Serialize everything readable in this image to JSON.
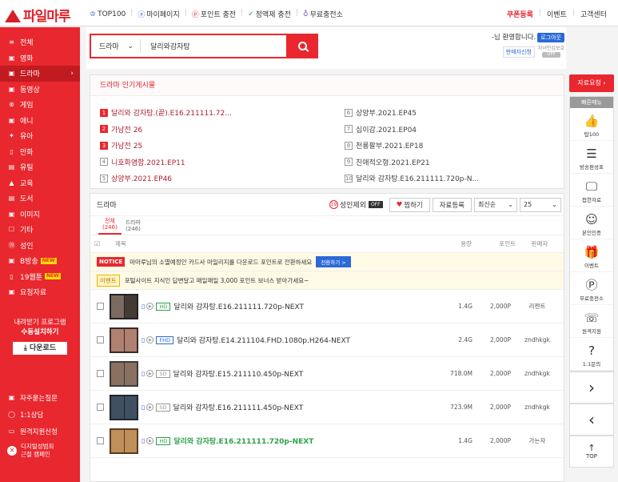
{
  "brand": {
    "name": "파일마루"
  },
  "topnav": [
    {
      "label": "TOP100",
      "icon": "crown-icon",
      "glyph": "♔"
    },
    {
      "label": "마이페이지",
      "icon": "user-icon",
      "glyph": "ⓐ"
    },
    {
      "label": "포인트 충전",
      "icon": "point-icon",
      "glyph": "ⓟ"
    },
    {
      "label": "정액제 충전",
      "icon": "check-circle-icon",
      "glyph": "✓"
    },
    {
      "label": "무료충전소",
      "icon": "gift-icon",
      "glyph": "♁"
    }
  ],
  "toplinks": {
    "coupon": "쿠폰등록",
    "event": "이벤트",
    "support": "고객센터"
  },
  "sidebar": {
    "items": [
      {
        "label": "전체",
        "icon": "menu-icon",
        "glyph": "≡"
      },
      {
        "label": "영화",
        "icon": "movie-icon",
        "glyph": "▣"
      },
      {
        "label": "드라마",
        "icon": "drama-icon",
        "glyph": "▣",
        "active": true
      },
      {
        "label": "동영상",
        "icon": "video-icon",
        "glyph": "▣"
      },
      {
        "label": "게임",
        "icon": "gamepad-icon",
        "glyph": "⊛"
      },
      {
        "label": "애니",
        "icon": "anime-icon",
        "glyph": "▣"
      },
      {
        "label": "유아",
        "icon": "child-icon",
        "glyph": "✦"
      },
      {
        "label": "만화",
        "icon": "book-icon",
        "glyph": "▯"
      },
      {
        "label": "유틸",
        "icon": "utility-icon",
        "glyph": "▤"
      },
      {
        "label": "교육",
        "icon": "education-icon",
        "glyph": "▲"
      },
      {
        "label": "도서",
        "icon": "library-icon",
        "glyph": "▤"
      },
      {
        "label": "이미지",
        "icon": "image-icon",
        "glyph": "▣"
      },
      {
        "label": "기타",
        "icon": "etc-icon",
        "glyph": "☐"
      },
      {
        "label": "성인",
        "icon": "adult-icon",
        "glyph": "⑲"
      },
      {
        "label": "B방송",
        "icon": "broadcast-icon",
        "glyph": "▣",
        "new": "NEW"
      },
      {
        "label": "19웹툰",
        "icon": "webtoon-icon",
        "glyph": "▯",
        "new": "NEW"
      },
      {
        "label": "요청자료",
        "icon": "request-icon",
        "glyph": "▣"
      }
    ],
    "promo_line1": "내려받기 프로그램",
    "promo_line2": "수동설치하기",
    "download_label": "다운로드",
    "bottom": [
      {
        "label": "자주묻는질문",
        "icon": "faq-icon",
        "glyph": "▣"
      },
      {
        "label": "1:1상담",
        "icon": "chat-icon",
        "glyph": "◯"
      },
      {
        "label": "원격지원신청",
        "icon": "remote-icon",
        "glyph": "▭"
      }
    ],
    "last_line1": "디지털성범죄",
    "last_line2": "근절 캠페인"
  },
  "search": {
    "category": "드라마",
    "query": "달리와감자탕"
  },
  "welcome": {
    "text": "-님 환영합니다.",
    "logout": "로그아웃",
    "filter_btn": "판매자신청",
    "safe_line1": "자녀안심보호",
    "safe_toggle": "OFF"
  },
  "popular": {
    "title": "드라마 인기게시물",
    "items": [
      {
        "rank": "1",
        "label": "달리와 감자탕.(끝).E16.211111.72..."
      },
      {
        "rank": "6",
        "label": "상양부.2021.EP45"
      },
      {
        "rank": "2",
        "label": "가남전 26"
      },
      {
        "rank": "7",
        "label": "십이감.2021.EP04"
      },
      {
        "rank": "3",
        "label": "가남전 25"
      },
      {
        "rank": "8",
        "label": "천룡팔부.2021.EP18"
      },
      {
        "rank": "4",
        "label": "니호화염함.2021.EP11"
      },
      {
        "rank": "9",
        "label": "친애적오형.2021.EP21"
      },
      {
        "rank": "5",
        "label": "상양부.2021.EP46"
      },
      {
        "rank": "10",
        "label": "달리와 감자탕.E16.211111.720p-N..."
      }
    ]
  },
  "list": {
    "title": "드라마",
    "adult_label": "성인제외",
    "adult_toggle": "OFF",
    "favorite": "찜하기",
    "register": "자료등록",
    "sort": "최신순",
    "page_size": "25",
    "tabs": [
      {
        "line1": "전체",
        "line2": "(246)"
      },
      {
        "line1": "드라마",
        "line2": "(246)"
      }
    ],
    "columns": {
      "title": "제목",
      "size": "용량",
      "point": "포인트",
      "seller": "판매자"
    },
    "notice_tag": "NOTICE",
    "notice_text": "마마루님의 소멸예정인 카드사 마일리지를 다운로드 포인트로 전환하세요",
    "notice_btn": "전환하기 >",
    "event_tag": "이벤트",
    "event_text": "포털사이트 지식인 답변달고 매일매일 3,000 포인트 보너스 받아가세요~",
    "rows": [
      {
        "quality": "HD",
        "title": "달리와 감자탕.E16.211111.720p-NEXT",
        "size": "1.4G",
        "point": "2,000P",
        "seller": "리젠트"
      },
      {
        "quality": "FHD",
        "title": "달리와 감자탕.E14.211104.FHD.1080p.H264-NEXT",
        "size": "2.4G",
        "point": "2,000P",
        "seller": "zndhkgk"
      },
      {
        "quality": "SD",
        "title": "달리와 감자탕.E15.211110.450p-NEXT",
        "size": "718.0M",
        "point": "2,000P",
        "seller": "zndhkgk"
      },
      {
        "quality": "SD",
        "title": "달리와 감자탕.E16.211111.450p-NEXT",
        "size": "723.9M",
        "point": "2,000P",
        "seller": "zndhkgk"
      },
      {
        "quality": "HD",
        "title": "달리와 감자탕.E16.211111.720p-NEXT",
        "size": "1.4G",
        "point": "2,000P",
        "seller": "가는자",
        "highlight": true
      }
    ]
  },
  "rightbar": {
    "request": "자료요청 ›",
    "quick_title": "빠른메뉴",
    "items": [
      {
        "label": "탑100",
        "icon": "thumbs-up-icon",
        "glyph": "👍"
      },
      {
        "label": "방송편성표",
        "icon": "schedule-icon",
        "glyph": "☰"
      },
      {
        "label": "접한자료",
        "icon": "monitor-icon",
        "glyph": "🖵"
      },
      {
        "label": "본인인증",
        "icon": "verify-user-icon",
        "glyph": "☺"
      },
      {
        "label": "이벤트",
        "icon": "gift-box-icon",
        "glyph": "🎁"
      },
      {
        "label": "무료충전소",
        "icon": "coin-icon",
        "glyph": "Ⓟ"
      },
      {
        "label": "원격지원",
        "icon": "remote-support-icon",
        "glyph": "☏"
      },
      {
        "label": "1:1문의",
        "icon": "inquiry-icon",
        "glyph": "?"
      }
    ],
    "next": "›",
    "prev": "‹",
    "top": "TOP"
  }
}
